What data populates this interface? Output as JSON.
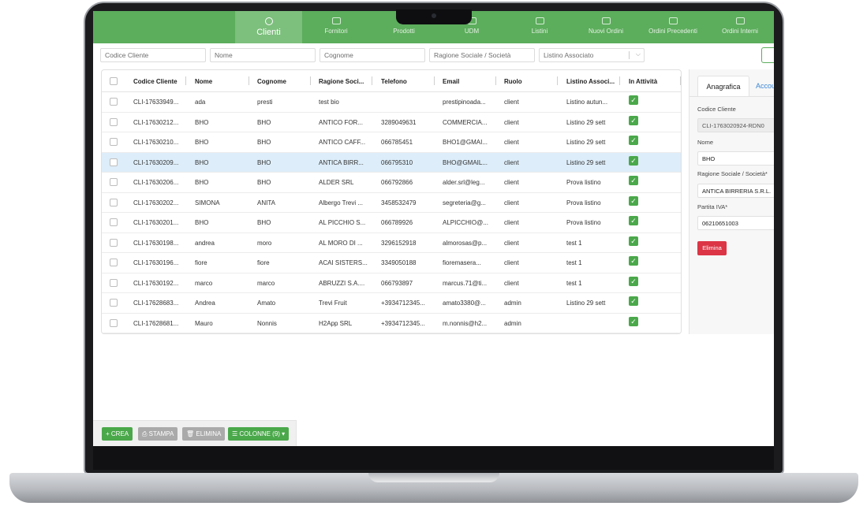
{
  "nav": {
    "items": [
      {
        "label": "Clienti",
        "icon": "users-icon",
        "active": true
      },
      {
        "label": "Fornitori",
        "icon": "truck-icon"
      },
      {
        "label": "Prodotti",
        "icon": "box-icon"
      },
      {
        "label": "UDM",
        "icon": "scale-icon"
      },
      {
        "label": "Listini",
        "icon": "list-icon"
      },
      {
        "label": "Nuovi Ordini",
        "icon": "order-icon"
      },
      {
        "label": "Ordini Precedenti",
        "icon": "history-icon"
      },
      {
        "label": "Ordini Interni",
        "icon": "internal-order-icon"
      }
    ]
  },
  "filters": {
    "codice_cliente": "Codice Cliente",
    "nome": "Nome",
    "cognome": "Cognome",
    "ragione_sociale": "Ragione Sociale / Società",
    "listino": "Listino Associato",
    "listino_caret": "⌵"
  },
  "table": {
    "headers": [
      "Codice Cliente",
      "Nome",
      "Cognome",
      "Ragione Soci...",
      "Telefono",
      "Email",
      "Ruolo",
      "Listino Associ...",
      "In Attività"
    ],
    "rows": [
      {
        "codice": "CLI-17633949...",
        "nome": "ada",
        "cognome": "presti",
        "ragione": "test bio",
        "telefono": "",
        "email": "prestipinoada...",
        "ruolo": "client",
        "listino": "Listino autun...",
        "attiva": "✓"
      },
      {
        "codice": "CLI-17630212...",
        "nome": "BHO",
        "cognome": "BHO",
        "ragione": "ANTICO FOR...",
        "telefono": "3289049631",
        "email": "COMMERCIA...",
        "ruolo": "client",
        "listino": "Listino 29 sett",
        "attiva": "✓"
      },
      {
        "codice": "CLI-17630210...",
        "nome": "BHO",
        "cognome": "BHO",
        "ragione": "ANTICO CAFF...",
        "telefono": "066785451",
        "email": "BHO1@GMAI...",
        "ruolo": "client",
        "listino": "Listino 29 sett",
        "attiva": "✓"
      },
      {
        "codice": "CLI-17630209...",
        "nome": "BHO",
        "cognome": "BHO",
        "ragione": "ANTICA BIRR...",
        "telefono": "066795310",
        "email": "BHO@GMAIL...",
        "ruolo": "client",
        "listino": "Listino 29 sett",
        "attiva": "✓"
      },
      {
        "codice": "CLI-17630206...",
        "nome": "BHO",
        "cognome": "BHO",
        "ragione": "ALDER SRL",
        "telefono": "066792866",
        "email": "alder.srl@leg...",
        "ruolo": "client",
        "listino": "Prova listino",
        "attiva": "✓"
      },
      {
        "codice": "CLI-17630202...",
        "nome": "SIMONA",
        "cognome": "ANITA",
        "ragione": "Albergo Trevi ...",
        "telefono": "3458532479",
        "email": "segreteria@g...",
        "ruolo": "client",
        "listino": "Prova listino",
        "attiva": "✓"
      },
      {
        "codice": "CLI-17630201...",
        "nome": "BHO",
        "cognome": "BHO",
        "ragione": "AL PICCHIO S...",
        "telefono": "066789926",
        "email": "ALPICCHIO@...",
        "ruolo": "client",
        "listino": "Prova listino",
        "attiva": "✓"
      },
      {
        "codice": "CLI-17630198...",
        "nome": "andrea",
        "cognome": "moro",
        "ragione": "AL MORO DI ...",
        "telefono": "3296152918",
        "email": "almorosas@p...",
        "ruolo": "client",
        "listino": "test 1",
        "attiva": "✓"
      },
      {
        "codice": "CLI-17630196...",
        "nome": "fiore",
        "cognome": "fiore",
        "ragione": "ACAI SISTERS...",
        "telefono": "3349050188",
        "email": "fioremasera...",
        "ruolo": "client",
        "listino": "test 1",
        "attiva": "✓"
      },
      {
        "codice": "CLI-17630192...",
        "nome": "marco",
        "cognome": "marco",
        "ragione": "ABRUZZI S.A....",
        "telefono": "066793897",
        "email": "marcus.71@ti...",
        "ruolo": "client",
        "listino": "test 1",
        "attiva": "✓"
      },
      {
        "codice": "CLI-17628683...",
        "nome": "Andrea",
        "cognome": "Amato",
        "ragione": "Trevi Fruit",
        "telefono": "+3934712345...",
        "email": "amato3380@...",
        "ruolo": "admin",
        "listino": "Listino 29 sett",
        "attiva": "✓"
      },
      {
        "codice": "CLI-17628681...",
        "nome": "Mauro",
        "cognome": "Nonnis",
        "ragione": "H2App SRL",
        "telefono": "+3934712345...",
        "email": "m.nonnis@h2...",
        "ruolo": "admin",
        "listino": "",
        "attiva": "✓"
      }
    ],
    "selected_index": 3
  },
  "panel": {
    "tab_active": "Anagrafica",
    "tab_other": "Accou",
    "codice_label": "Codice Cliente",
    "codice_value": "CLI-1763020924-RDN0",
    "nome_label": "Nome",
    "nome_value": "BHO",
    "ragione_label": "Ragione Sociale / Società*",
    "ragione_value": "ANTICA BIRRERIA S.R.L.",
    "piva_label": "Partita IVA*",
    "piva_value": "06210651003",
    "delete_label": "Elimina"
  },
  "toolbar": {
    "crea": "+ CREA",
    "stampa": "⎙ STAMPA",
    "elimina": "🗑 ELIMINA",
    "colonne": "☰ COLONNE (9) ▾"
  },
  "colors": {
    "primary_green": "#5cad5c",
    "selected_row": "#ddedf9",
    "danger": "#dc3545"
  }
}
